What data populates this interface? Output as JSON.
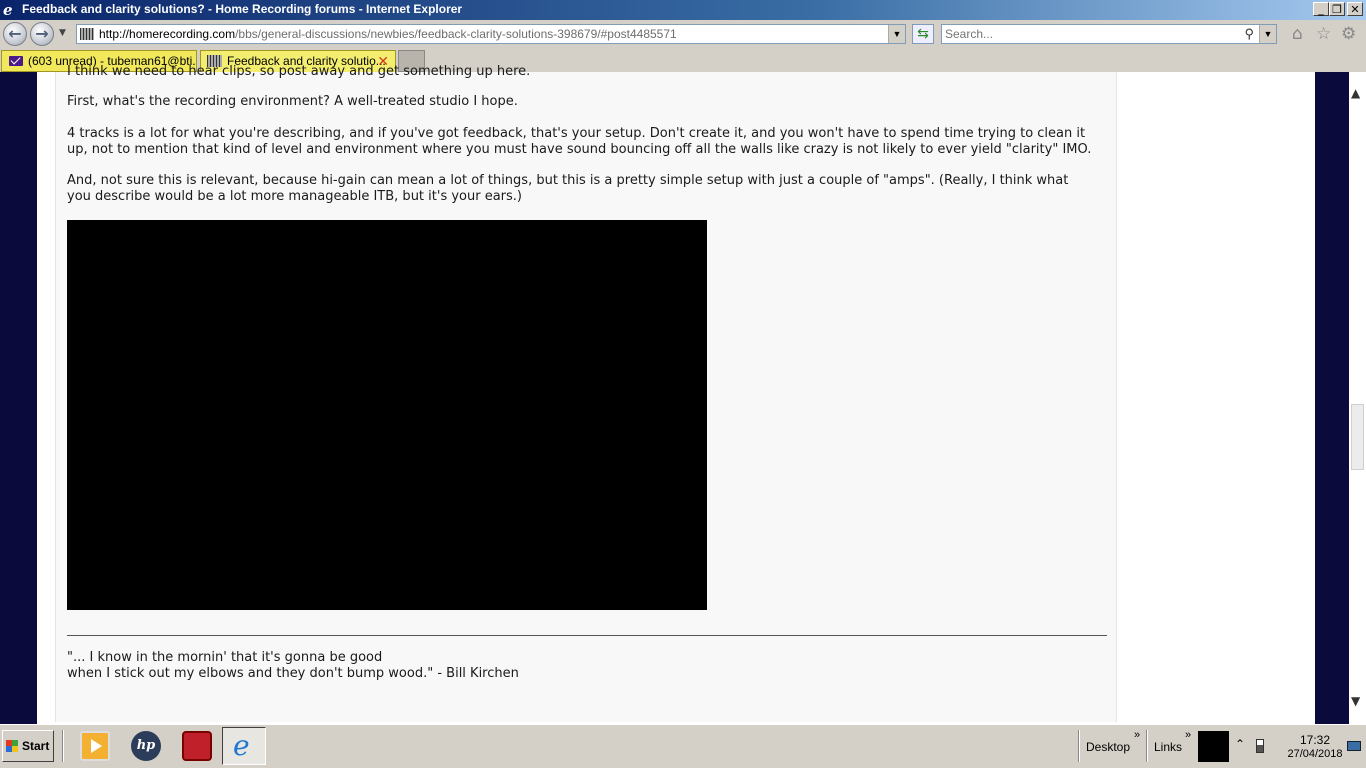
{
  "window": {
    "title": "Feedback and clarity solutions? - Home Recording forums - Internet Explorer",
    "ie_logo": "e",
    "minimize": "_",
    "restore": "❐",
    "close": "✕"
  },
  "nav": {
    "back": "←",
    "forward": "→",
    "history_dropdown": "▼",
    "url_domain": "http://homerecording.com",
    "url_path": "/bbs/general-discussions/newbies/feedback-clarity-solutions-398679/#post4485571",
    "address_dropdown": "▼",
    "refresh": "⇆",
    "search_placeholder": "Search...",
    "search_icon": "⚲",
    "search_dropdown": "▼",
    "home_icon": "⌂",
    "favorites_icon": "☆",
    "tools_icon": "⚙"
  },
  "tabs": [
    {
      "label": "(603 unread) - tubeman61@bti...",
      "icon": "mail-icon"
    },
    {
      "label": "Feedback and clarity solutio...",
      "icon": "homerecording-icon",
      "close": "✕"
    }
  ],
  "post": {
    "partial_line": "I think we need to hear clips, so post away and get something up here.",
    "p1": "First, what's the recording environment? A well-treated studio I hope.",
    "p2_line1": "4 tracks is a lot for what you're describing, and if you've got feedback, that's your setup. Don't create it, and you won't have to spend time trying to clean it",
    "p2_line2": "up, not to mention that kind of level and environment where you must have sound bouncing off all the walls like crazy is not likely to ever yield \"clarity\" IMO.",
    "p3_line1": "And, not sure this is relevant, because hi-gain can mean a lot of things, but this is a pretty simple setup with just a couple of \"amps\". (Really, I think what",
    "p3_line2": "you describe would be a lot more manageable ITB, but it's your ears.)",
    "sig_line1": "\"... I know in the mornin' that it's gonna be good",
    "sig_line2": "when I stick out my elbows and they don't bump wood.\" - Bill Kirchen"
  },
  "scrollbar": {
    "up": "▲",
    "down": "▼"
  },
  "taskbar": {
    "start_label": "Start",
    "hp_label": "hp",
    "ie_label": "e",
    "desktop_label": "Desktop",
    "links_label": "Links",
    "chevron": "»",
    "tray_up": "⌃",
    "time": "17:32",
    "date": "27/04/2018"
  }
}
